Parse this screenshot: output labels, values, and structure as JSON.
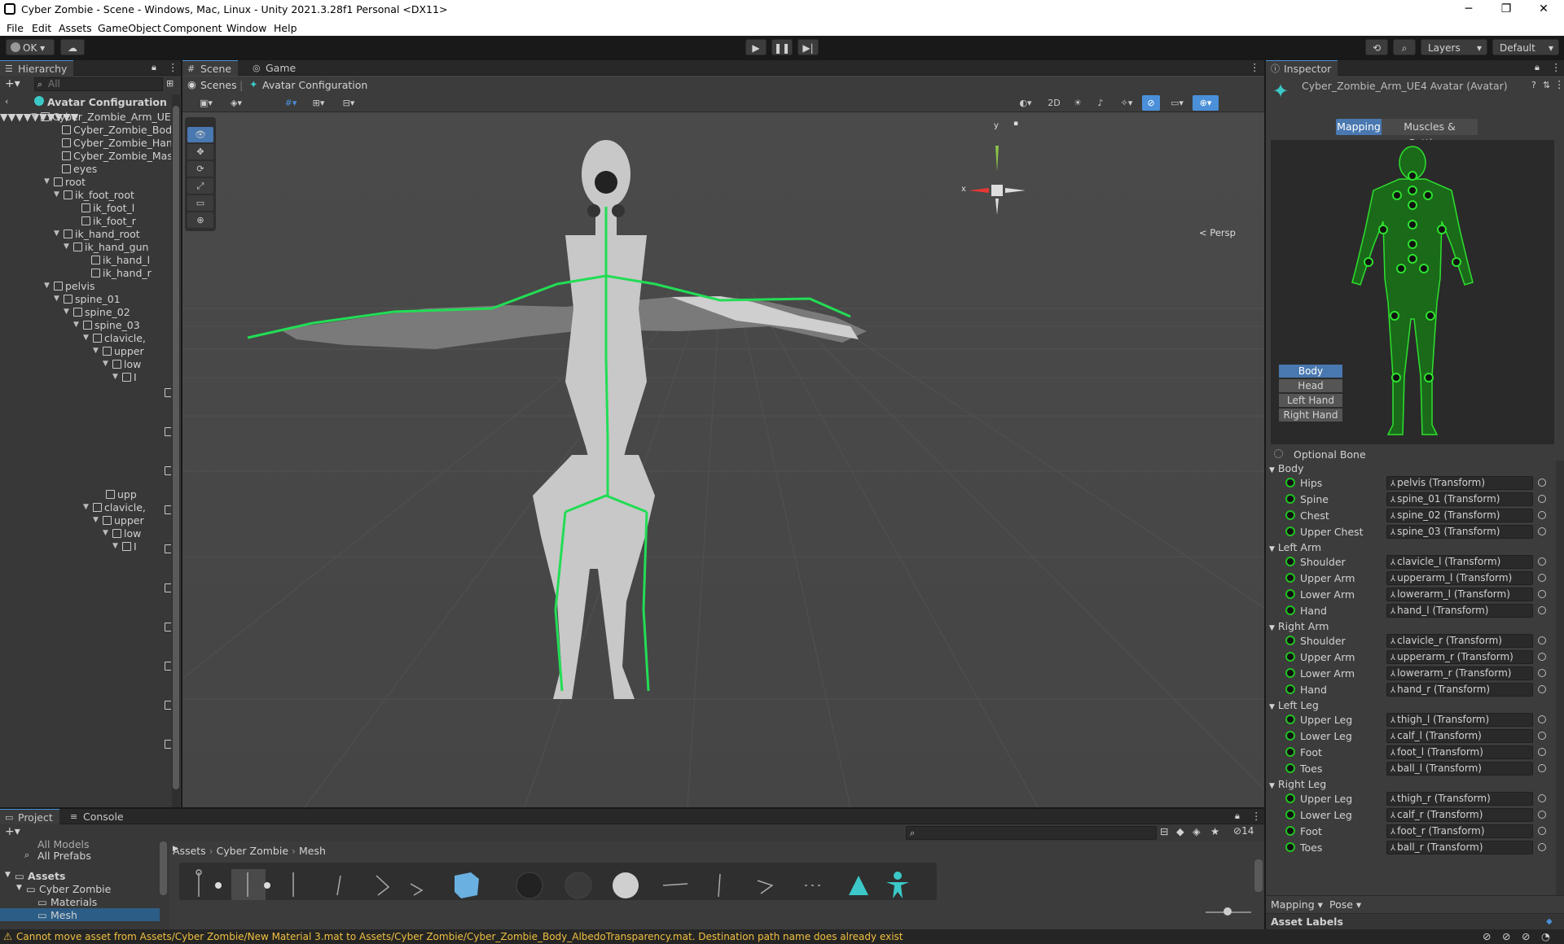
{
  "window": {
    "title": "Cyber Zombie - Scene - Windows, Mac, Linux - Unity 2021.3.28f1 Personal <DX11>",
    "minimize": "─",
    "restore": "❐",
    "close": "✕"
  },
  "menu": [
    "File",
    "Edit",
    "Assets",
    "GameObject",
    "Component",
    "Window",
    "Help"
  ],
  "toolbar": {
    "account": "OK",
    "layers": "Layers",
    "layout": "Default"
  },
  "hierarchy": {
    "tab": "Hierarchy",
    "search_placeholder": "All",
    "root": "Avatar Configuration",
    "items": [
      "Cyber_Zombie_Arm_UE",
      "Cyber_Zombie_Body",
      "Cyber_Zombie_Hand",
      "Cyber_Zombie_Mask",
      "eyes",
      "root",
      "ik_foot_root",
      "ik_foot_l",
      "ik_foot_r",
      "ik_hand_root",
      "ik_hand_gun",
      "ik_hand_l",
      "ik_hand_r",
      "pelvis",
      "spine_01",
      "spine_02",
      "spine_03",
      "clavicle,",
      "upper",
      "low",
      "I",
      "upp",
      "clavicle,",
      "upper",
      "low",
      "I"
    ]
  },
  "scene": {
    "tabs": [
      "Scene",
      "Game"
    ],
    "breadcrumb": [
      "Scenes",
      "Avatar Configuration"
    ],
    "btn_2d": "2D",
    "persp": "Persp",
    "axis_y": "y",
    "axis_x": "x"
  },
  "inspector": {
    "tab": "Inspector",
    "object": "Cyber_Zombie_Arm_UE4 Avatar (Avatar)",
    "mode_tabs": [
      "Mapping",
      "Muscles & Settings"
    ],
    "body_buttons": [
      "Body",
      "Head",
      "Left Hand",
      "Right Hand"
    ],
    "optional_bone": "Optional Bone",
    "sections": [
      {
        "name": "Body",
        "bones": [
          [
            "Hips",
            "pelvis (Transform)"
          ],
          [
            "Spine",
            "spine_01 (Transform)"
          ],
          [
            "Chest",
            "spine_02 (Transform)"
          ],
          [
            "Upper Chest",
            "spine_03 (Transform)"
          ]
        ]
      },
      {
        "name": "Left Arm",
        "bones": [
          [
            "Shoulder",
            "clavicle_l (Transform)"
          ],
          [
            "Upper Arm",
            "upperarm_l (Transform)"
          ],
          [
            "Lower Arm",
            "lowerarm_l (Transform)"
          ],
          [
            "Hand",
            "hand_l (Transform)"
          ]
        ]
      },
      {
        "name": "Right Arm",
        "bones": [
          [
            "Shoulder",
            "clavicle_r (Transform)"
          ],
          [
            "Upper Arm",
            "upperarm_r (Transform)"
          ],
          [
            "Lower Arm",
            "lowerarm_r (Transform)"
          ],
          [
            "Hand",
            "hand_r (Transform)"
          ]
        ]
      },
      {
        "name": "Left Leg",
        "bones": [
          [
            "Upper Leg",
            "thigh_l (Transform)"
          ],
          [
            "Lower Leg",
            "calf_l (Transform)"
          ],
          [
            "Foot",
            "foot_l (Transform)"
          ],
          [
            "Toes",
            "ball_l (Transform)"
          ]
        ]
      },
      {
        "name": "Right Leg",
        "bones": [
          [
            "Upper Leg",
            "thigh_r (Transform)"
          ],
          [
            "Lower Leg",
            "calf_r (Transform)"
          ],
          [
            "Foot",
            "foot_r (Transform)"
          ],
          [
            "Toes",
            "ball_r (Transform)"
          ]
        ]
      }
    ],
    "mapping_menu": "Mapping",
    "pose_menu": "Pose",
    "asset_labels": "Asset Labels"
  },
  "project": {
    "tabs": [
      "Project",
      "Console"
    ],
    "hidden_count": "14",
    "favorites": [
      "All Models",
      "All Prefabs"
    ],
    "assets_root": "Assets",
    "folders": [
      "Cyber Zombie",
      "Materials",
      "Mesh"
    ],
    "breadcrumb": [
      "Assets",
      "Cyber Zombie",
      "Mesh"
    ]
  },
  "status": {
    "message": "Cannot move asset from Assets/Cyber Zombie/New Material 3.mat to Assets/Cyber Zombie/Cyber_Zombie_Body_AlbedoTransparency.mat. Destination path name does already exist"
  },
  "colors": {
    "accent": "#4a90d9",
    "bone_green": "#22c022",
    "warning": "#f0c040"
  }
}
